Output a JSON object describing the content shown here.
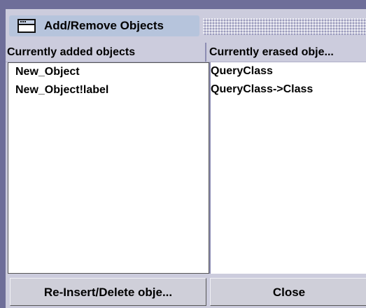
{
  "window": {
    "title": "Add/Remove Objects"
  },
  "columns": {
    "left_header": "Currently added objects",
    "right_header": "Currently erased obje..."
  },
  "added_objects": [
    "New_Object",
    "New_Object!label"
  ],
  "erased_objects": [
    "QueryClass",
    "QueryClass->Class"
  ],
  "buttons": {
    "reinsert_label": "Re-Insert/Delete obje...",
    "close_label": "Close"
  },
  "icons": {
    "window": "window-icon"
  },
  "colors": {
    "desktop": "#6e6e99",
    "panel": "#ccccdd",
    "title_highlight": "#b6c4dc",
    "list_bg": "#ffffff"
  }
}
